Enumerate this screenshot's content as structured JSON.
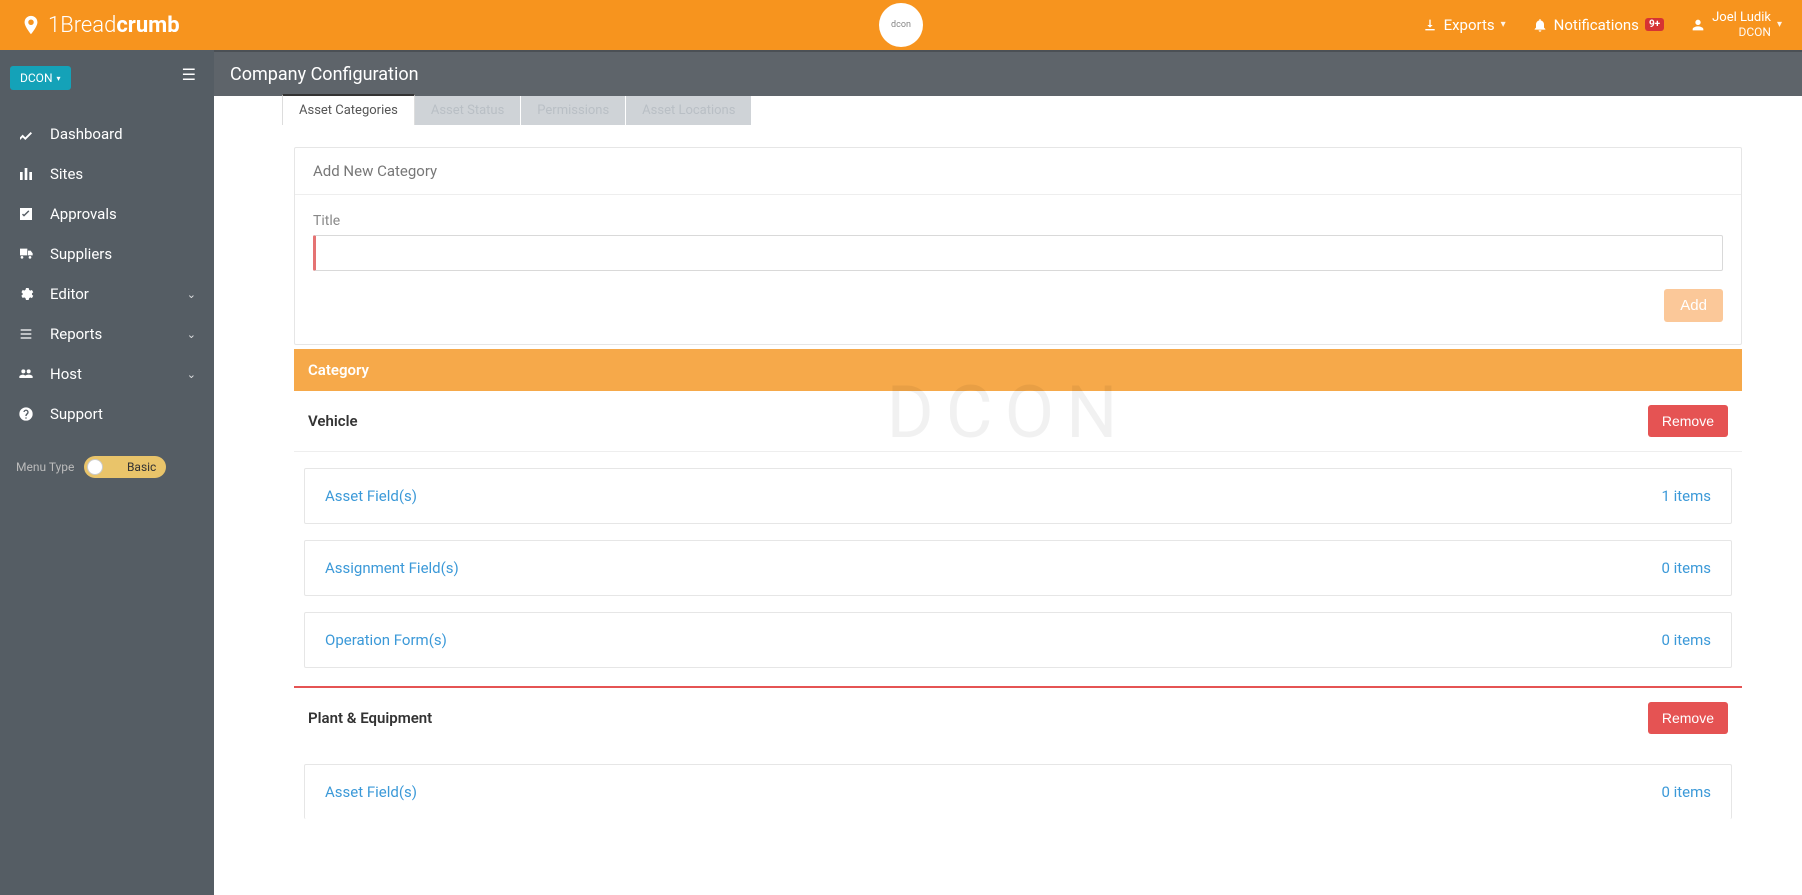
{
  "brand": {
    "part1": "1Bread",
    "part2": "crumb"
  },
  "topbar": {
    "center_logo_text": "dcon",
    "exports": "Exports",
    "notifications": "Notifications",
    "notif_badge": "9+",
    "user_name": "Joel Ludik",
    "user_org": "DCON"
  },
  "org_selector": "DCON",
  "sidebar": {
    "items": [
      {
        "label": "Dashboard",
        "expandable": false
      },
      {
        "label": "Sites",
        "expandable": false
      },
      {
        "label": "Approvals",
        "expandable": false
      },
      {
        "label": "Suppliers",
        "expandable": false
      },
      {
        "label": "Editor",
        "expandable": true
      },
      {
        "label": "Reports",
        "expandable": true
      },
      {
        "label": "Host",
        "expandable": true
      },
      {
        "label": "Support",
        "expandable": false
      }
    ],
    "menu_type_label": "Menu Type",
    "menu_type_value": "Basic"
  },
  "page_title": "Company Configuration",
  "tabs": [
    {
      "label": "Asset Categories",
      "active": true
    },
    {
      "label": "Asset Status",
      "active": false
    },
    {
      "label": "Permissions",
      "active": false
    },
    {
      "label": "Asset Locations",
      "active": false
    }
  ],
  "add_panel": {
    "heading": "Add New Category",
    "field_label": "Title",
    "input_value": "",
    "add_button": "Add"
  },
  "category_header": "Category",
  "remove_label": "Remove",
  "categories": [
    {
      "name": "Vehicle",
      "rows": [
        {
          "label": "Asset Field(s)",
          "count": "1 items"
        },
        {
          "label": "Assignment Field(s)",
          "count": "0 items"
        },
        {
          "label": "Operation Form(s)",
          "count": "0 items"
        }
      ]
    },
    {
      "name": "Plant & Equipment",
      "rows": [
        {
          "label": "Asset Field(s)",
          "count": "0 items"
        }
      ]
    }
  ]
}
